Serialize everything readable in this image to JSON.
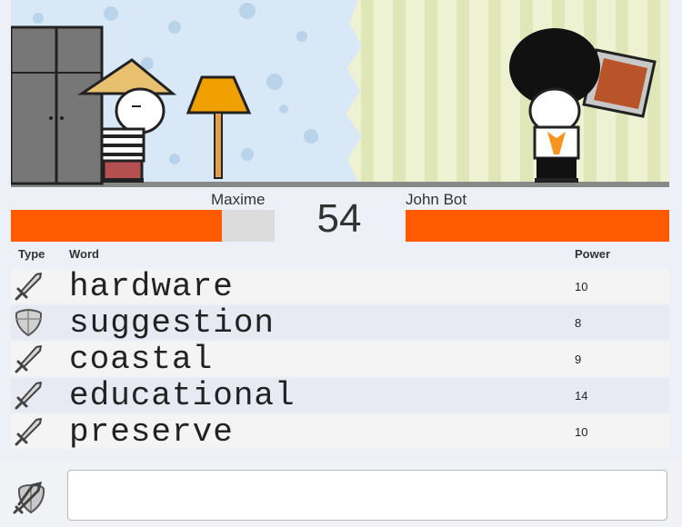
{
  "players": {
    "left": {
      "name": "Maxime",
      "health_fraction": 0.8
    },
    "right": {
      "name": "John Bot",
      "health_fraction": 1.0
    }
  },
  "timer": "54",
  "table": {
    "headers": {
      "type": "Type",
      "word": "Word",
      "power": "Power"
    },
    "rows": [
      {
        "type": "sword-icon",
        "word": "hardware",
        "power": "10"
      },
      {
        "type": "shield-icon",
        "word": "suggestion",
        "power": "8"
      },
      {
        "type": "sword-icon",
        "word": "coastal",
        "power": "9"
      },
      {
        "type": "sword-icon",
        "word": "educational",
        "power": "14"
      },
      {
        "type": "sword-icon",
        "word": "preserve",
        "power": "10"
      }
    ]
  },
  "input": {
    "value": "",
    "icon": "sword-shield-icon"
  },
  "colors": {
    "health": "#ff5a00",
    "health_empty": "#dcdcdc"
  }
}
